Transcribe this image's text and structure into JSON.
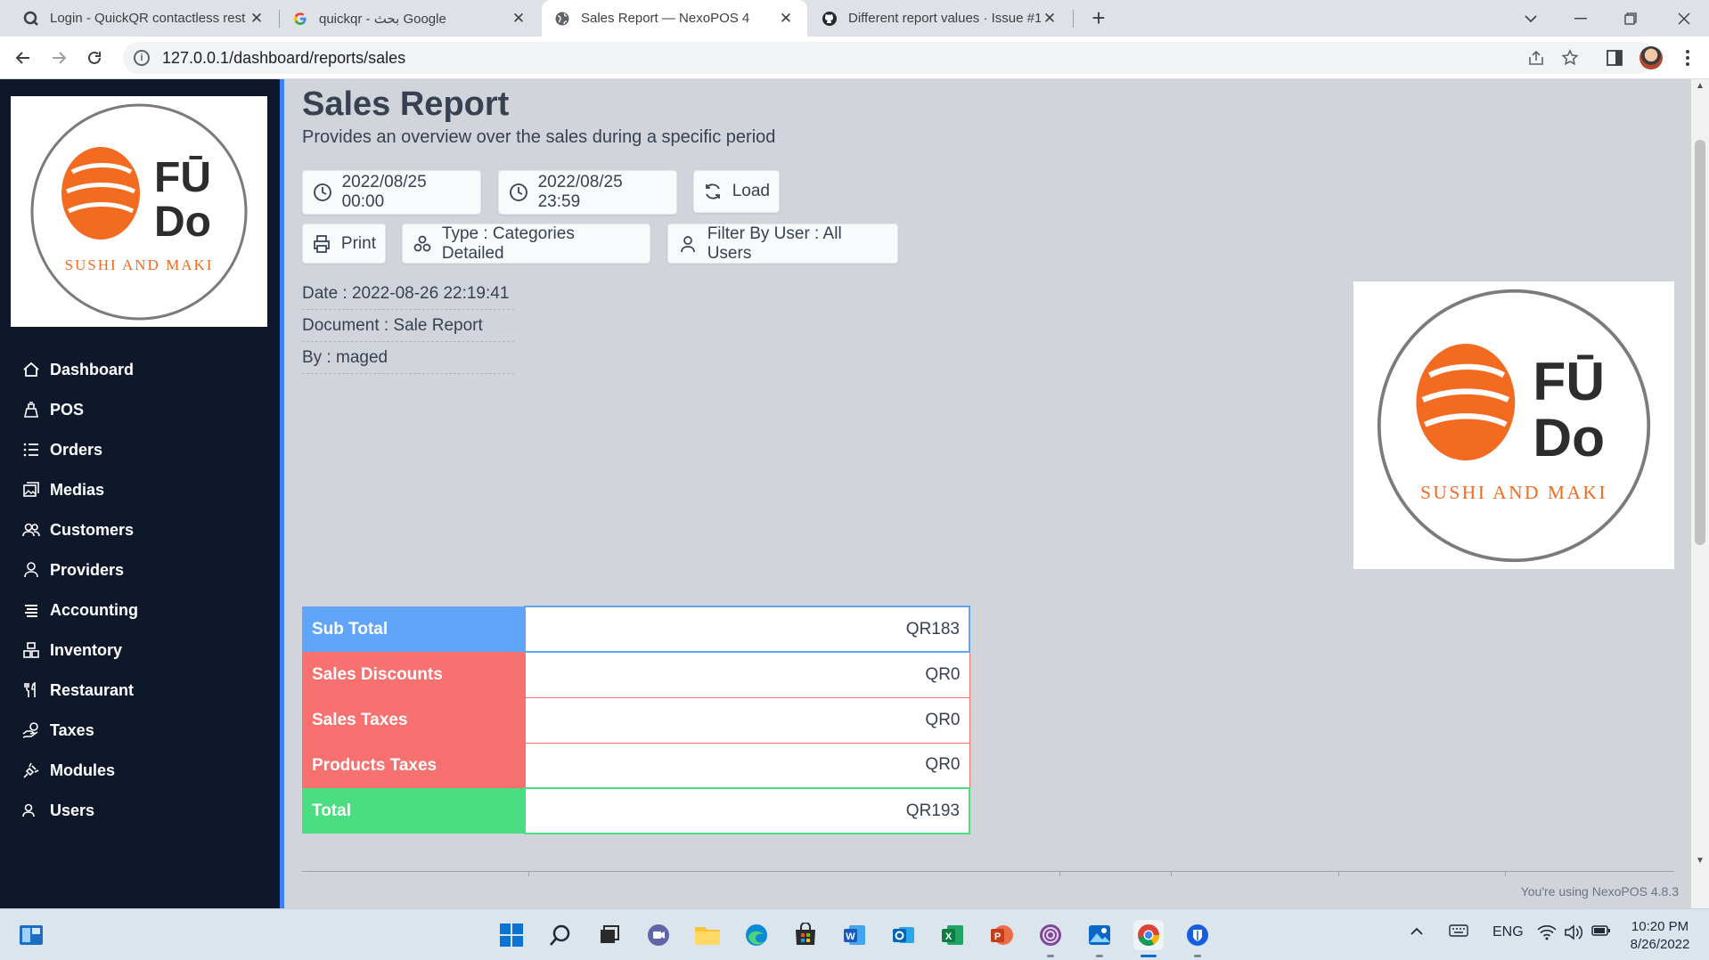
{
  "browser": {
    "tabs": [
      {
        "title": "Login - QuickQR contactless rest",
        "favicon": "quickqr-favicon-icon"
      },
      {
        "title": "quickqr - بحث Google",
        "favicon": "google-favicon-icon"
      },
      {
        "title": "Sales Report — NexoPOS 4",
        "favicon": "globe-icon",
        "active": true
      },
      {
        "title": "Different report values · Issue #1(",
        "favicon": "github-icon"
      }
    ],
    "url": "127.0.0.1/dashboard/reports/sales"
  },
  "sidebar": {
    "logo": {
      "brand_top": "FŪ",
      "brand_bottom": "Do",
      "tagline": "SUSHI AND MAKI"
    },
    "items": [
      {
        "label": "Dashboard",
        "icon": "home-icon"
      },
      {
        "label": "POS",
        "icon": "cash-register-icon"
      },
      {
        "label": "Orders",
        "icon": "list-icon"
      },
      {
        "label": "Medias",
        "icon": "images-icon"
      },
      {
        "label": "Customers",
        "icon": "users-icon"
      },
      {
        "label": "Providers",
        "icon": "user-icon"
      },
      {
        "label": "Accounting",
        "icon": "stack-icon"
      },
      {
        "label": "Inventory",
        "icon": "boxes-icon"
      },
      {
        "label": "Restaurant",
        "icon": "cutlery-icon"
      },
      {
        "label": "Taxes",
        "icon": "hand-money-icon"
      },
      {
        "label": "Modules",
        "icon": "plug-icon"
      },
      {
        "label": "Users",
        "icon": "users-cog-icon"
      }
    ]
  },
  "main": {
    "title": "Sales Report",
    "subtitle": "Provides an overview over the sales during a specific period",
    "start_date": "2022/08/25 00:00",
    "end_date": "2022/08/25 23:59",
    "load_label": "Load",
    "print_label": "Print",
    "type_label": "Type : Categories Detailed",
    "filter_label": "Filter By User : All Users",
    "meta": {
      "date": "Date : 2022-08-26 22:19:41",
      "document": "Document : Sale Report",
      "by": "By : maged"
    },
    "summary": [
      {
        "label": "Sub Total",
        "value": "QR183",
        "color": "#60a5fa"
      },
      {
        "label": "Sales Discounts",
        "value": "QR0",
        "color": "#f87171"
      },
      {
        "label": "Sales Taxes",
        "value": "QR0",
        "color": "#f87171"
      },
      {
        "label": "Products Taxes",
        "value": "QR0",
        "color": "#f87171"
      },
      {
        "label": "Total",
        "value": "QR193",
        "color": "#4ade80"
      }
    ],
    "version": "You're using NexoPOS 4.8.3"
  },
  "taskbar": {
    "lang": "ENG",
    "time": "10:20 PM",
    "date": "8/26/2022"
  },
  "colors": {
    "sidebar_bg": "#0f172a",
    "accent": "#3b82f6",
    "logo_orange": "#f26b21"
  }
}
